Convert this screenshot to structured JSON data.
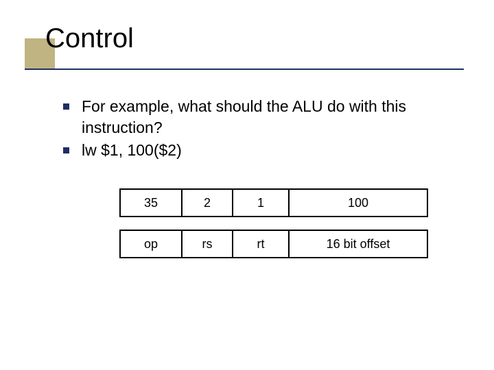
{
  "title": "Control",
  "bullets": [
    "For example,  what should the ALU do with this instruction?",
    "lw $1, 100($2)"
  ],
  "instruction_row": {
    "op": "35",
    "rs": "2",
    "rt": "1",
    "imm": "100"
  },
  "field_row": {
    "op": "op",
    "rs": "rs",
    "rt": "rt",
    "imm": "16 bit offset"
  }
}
